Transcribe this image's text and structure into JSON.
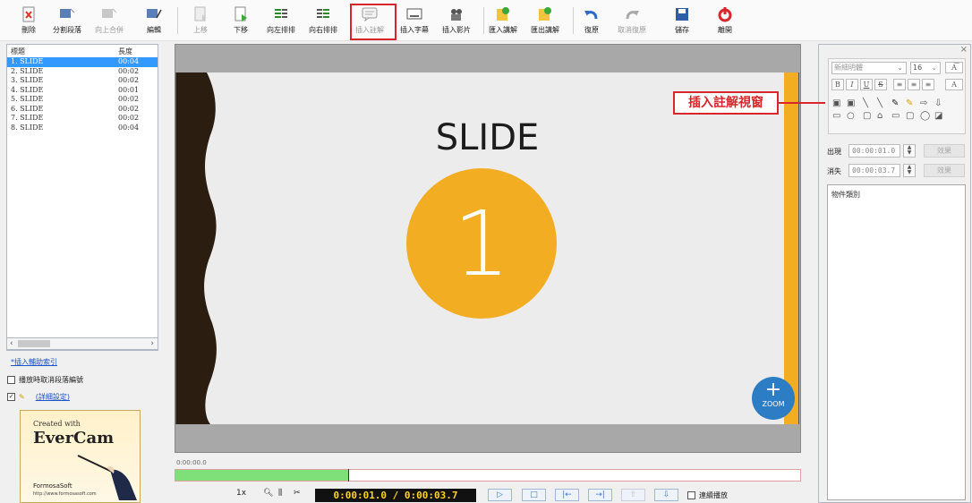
{
  "toolbar": {
    "delete": "刪除",
    "split": "分割段落",
    "merge_up": "向上合併",
    "edit": "編輯",
    "move_up": "上移",
    "move_down": "下移",
    "left_align": "向左排排",
    "right_align": "向右排排",
    "insert_annotation": "插入註解",
    "insert_subtitle": "插入字幕",
    "insert_video": "插入影片",
    "import_annotation": "匯入講解",
    "export_annotation": "匯出講解",
    "undo": "復原",
    "redo": "取消復原",
    "save": "儲存",
    "exit": "離開"
  },
  "slide_list": {
    "col_title": "標題",
    "col_length": "長度",
    "rows": [
      {
        "title": "1. SLIDE",
        "length": "00:04"
      },
      {
        "title": "2. SLIDE",
        "length": "00:02"
      },
      {
        "title": "3. SLIDE",
        "length": "00:02"
      },
      {
        "title": "4. SLIDE",
        "length": "00:01"
      },
      {
        "title": "5. SLIDE",
        "length": "00:02"
      },
      {
        "title": "6. SLIDE",
        "length": "00:02"
      },
      {
        "title": "7. SLIDE",
        "length": "00:02"
      },
      {
        "title": "8. SLIDE",
        "length": "00:04"
      }
    ]
  },
  "left_options": {
    "insert_index": "*插入輔助索引",
    "skip_playback": "播放時取消段落編號",
    "detail_settings": "(詳細設定)"
  },
  "logo": {
    "created_with": "Created with",
    "product": "EverCam",
    "company": "FormosaSoft",
    "url": "http://www.formosasoft.com"
  },
  "slide": {
    "title": "SLIDE",
    "number": "1",
    "zoom_label": "ZOOM"
  },
  "timeline": {
    "timecode": "0:00:00.0",
    "progress": 0.277
  },
  "playback": {
    "speed": "1x",
    "clock": "0:00:01.0 / 0:00:03.7",
    "continuous": "連續播放"
  },
  "annotation_panel": {
    "callout": "插入註解視窗",
    "font": "新細明體",
    "size": "16",
    "appear_label": "出現",
    "appear_time": "00:00:01.0",
    "disappear_label": "消失",
    "disappear_time": "00:00:03.7",
    "effect": "效果",
    "object_category": "物件類別"
  },
  "colors": {
    "accent_orange": "#f2ad22",
    "selection_blue": "#3399ff",
    "highlight_red": "#d9262b",
    "zoom_blue": "#2d7dc4"
  }
}
